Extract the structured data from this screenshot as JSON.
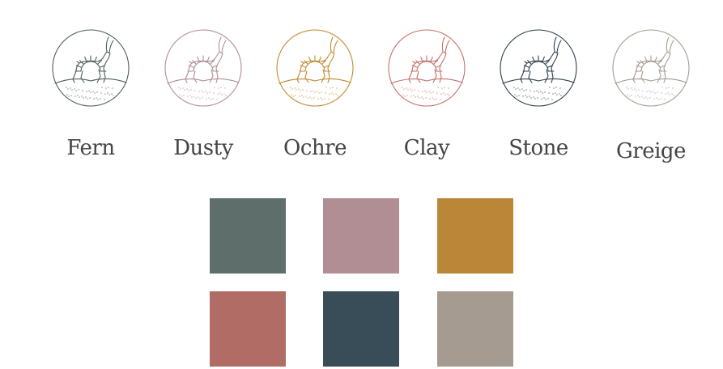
{
  "colors": [
    {
      "name": "Fern",
      "hex": "#5e6e6b",
      "line": "#4f5f5c"
    },
    {
      "name": "Dusty",
      "hex": "#b08e93",
      "line": "#b08e93"
    },
    {
      "name": "Ochre",
      "hex": "#bb8638",
      "line": "#c18a2e"
    },
    {
      "name": "Clay",
      "hex": "#b16d65",
      "line": "#c4706a"
    },
    {
      "name": "Stone",
      "hex": "#394d59",
      "line": "#2f3f4c"
    },
    {
      "name": "Greige",
      "hex": "#a59b91",
      "line": "#a59b91"
    }
  ],
  "label_color": "#444444",
  "icon": "antelope-sun-emblem"
}
